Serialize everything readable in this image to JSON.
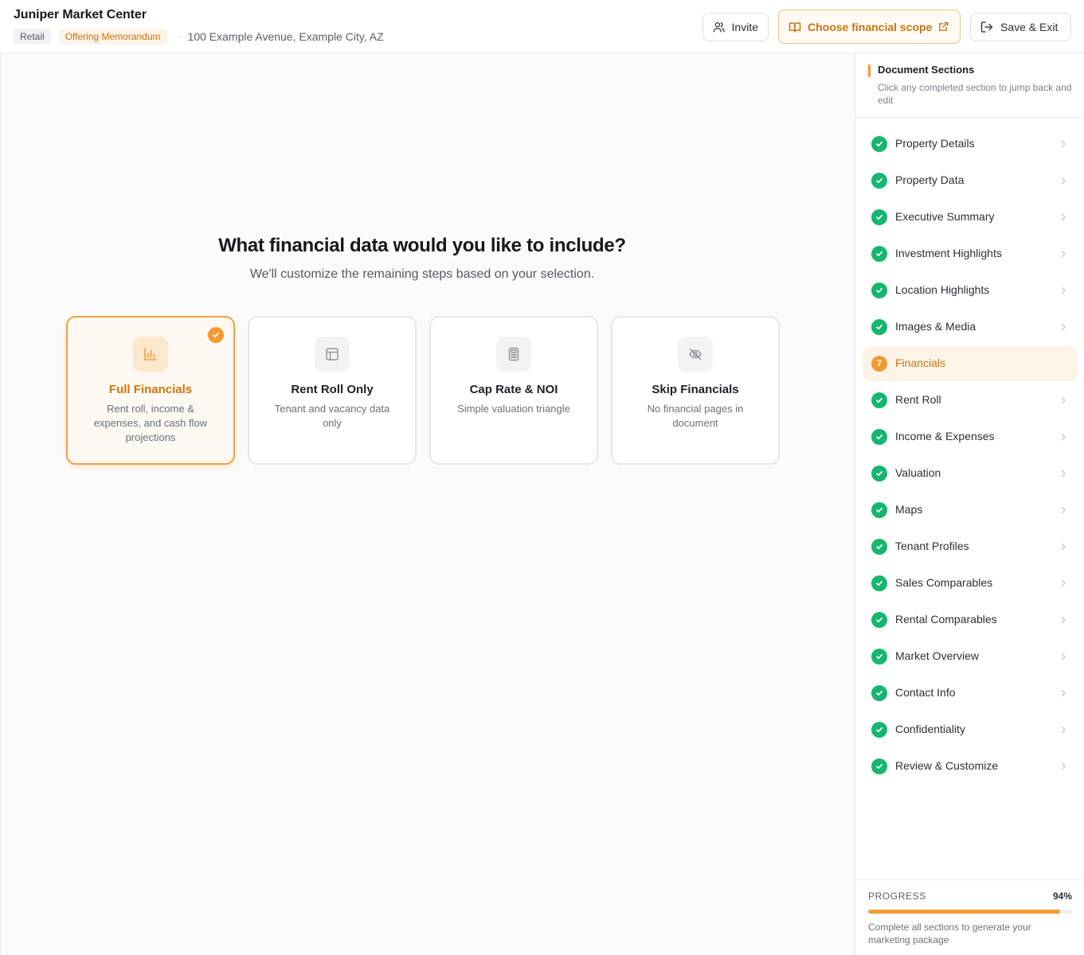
{
  "header": {
    "title": "Juniper Market Center",
    "tags": [
      "Retail",
      "Offering Memorandum"
    ],
    "address": "100 Example Avenue, Example City, AZ",
    "invite_label": "Invite",
    "scope_label": "Choose financial scope",
    "save_label": "Save & Exit"
  },
  "main": {
    "question": "What financial data would you like to include?",
    "subtitle": "We'll customize the remaining steps based on your selection.",
    "options": [
      {
        "title": "Full Financials",
        "desc": "Rent roll, income & expenses, and cash flow projections",
        "icon": "bar-chart-icon",
        "selected": true
      },
      {
        "title": "Rent Roll Only",
        "desc": "Tenant and vacancy data only",
        "icon": "table-icon",
        "selected": false
      },
      {
        "title": "Cap Rate & NOI",
        "desc": "Simple valuation triangle",
        "icon": "calculator-icon",
        "selected": false
      },
      {
        "title": "Skip Financials",
        "desc": "No financial pages in document",
        "icon": "eye-off-icon",
        "selected": false
      }
    ]
  },
  "sidebar": {
    "title": "Document Sections",
    "subtitle": "Click any completed section to jump back and edit",
    "items": [
      {
        "label": "Property Details",
        "status": "complete"
      },
      {
        "label": "Property Data",
        "status": "complete"
      },
      {
        "label": "Executive Summary",
        "status": "complete"
      },
      {
        "label": "Investment Highlights",
        "status": "complete"
      },
      {
        "label": "Location Highlights",
        "status": "complete"
      },
      {
        "label": "Images & Media",
        "status": "complete"
      },
      {
        "label": "Financials",
        "status": "active",
        "step": "7"
      },
      {
        "label": "Rent Roll",
        "status": "complete"
      },
      {
        "label": "Income & Expenses",
        "status": "complete"
      },
      {
        "label": "Valuation",
        "status": "complete"
      },
      {
        "label": "Maps",
        "status": "complete"
      },
      {
        "label": "Tenant Profiles",
        "status": "complete"
      },
      {
        "label": "Sales Comparables",
        "status": "complete"
      },
      {
        "label": "Rental Comparables",
        "status": "complete"
      },
      {
        "label": "Market Overview",
        "status": "complete"
      },
      {
        "label": "Contact Info",
        "status": "complete"
      },
      {
        "label": "Confidentiality",
        "status": "complete"
      },
      {
        "label": "Review & Customize",
        "status": "complete"
      }
    ],
    "progress_label": "PROGRESS",
    "progress_value": "94%",
    "progress_fraction": 0.94,
    "progress_note": "Complete all sections to generate your marketing package"
  },
  "colors": {
    "accent": "#f29b33",
    "success": "#16b66e"
  }
}
